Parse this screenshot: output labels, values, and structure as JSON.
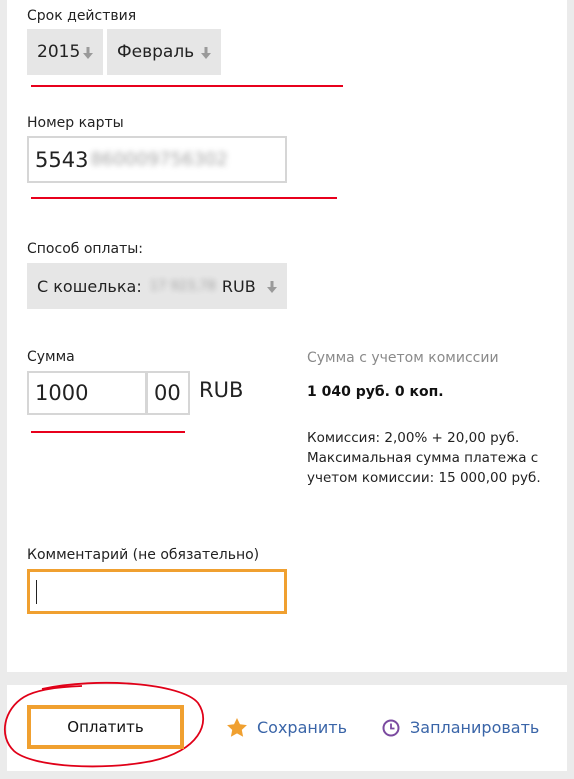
{
  "expiry": {
    "label": "Срок действия",
    "year": "2015",
    "month": "Февраль"
  },
  "card": {
    "label": "Номер карты",
    "number_visible": "5543",
    "number_obscured": "860009756302"
  },
  "payment_method": {
    "label": "Способ оплаты:",
    "value_prefix": "С кошелька:",
    "value_obscured": "17 923,78",
    "currency": "RUB"
  },
  "amount": {
    "label": "Сумма",
    "rubles": "1000",
    "kopecks": "00",
    "currency": "RUB"
  },
  "commission_info": {
    "title": "Сумма с учетом комиссии",
    "total": "1 040 руб. 0 коп.",
    "details": "Комиссия: 2,00% + 20,00 руб. Максимальная сумма платежа с учетом комиссии: 15 000,00 руб."
  },
  "comment": {
    "label": "Комментарий (не обязательно)",
    "value": ""
  },
  "actions": {
    "pay_label": "Оплатить",
    "save_label": "Сохранить",
    "schedule_label": "Запланировать"
  },
  "colors": {
    "accent_orange": "#f0a030",
    "annotation_red": "#e8001c",
    "link_blue": "#3a65a8",
    "star_orange": "#f0a030",
    "clock_purple": "#7b4aa0"
  }
}
